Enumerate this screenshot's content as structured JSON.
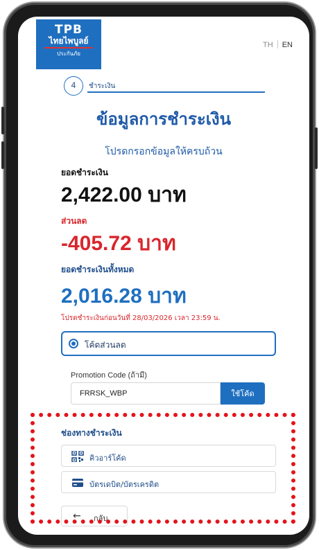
{
  "header": {
    "logo_title": "TPB",
    "logo_name": "ไทยไพบูลย์",
    "logo_sub": "ประกันภัย",
    "lang_th": "TH",
    "lang_en": "EN"
  },
  "step": {
    "number": "4",
    "label": "ชำระเงิน"
  },
  "page": {
    "title": "ข้อมูลการชำระเงิน",
    "subtitle": "โปรดกรอกข้อมูลให้ครบถ้วน"
  },
  "amounts": {
    "total_label": "ยอดชำระเงิน",
    "total_value": "2,422.00 บาท",
    "discount_label": "ส่วนลด",
    "discount_value": "-405.72 บาท",
    "grand_label": "ยอดชำระเงินทั้งหมด",
    "grand_value": "2,016.28 บาท",
    "due_note": "โปรดชำระเงินก่อนวันที่ 28/03/2026 เวลา 23:59 น."
  },
  "discount_option": {
    "label": "โค้ดส่วนลด",
    "selected": true
  },
  "promo": {
    "label": "Promotion Code (ถ้ามี)",
    "value": "FRRSK_WBP",
    "button": "ใช้โค้ด"
  },
  "payment": {
    "title": "ช่องทางชำระเงิน",
    "options": [
      {
        "label": "คิวอาร์โค้ด",
        "icon": "qr-code-icon"
      },
      {
        "label": "บัตรเดบิต/บัตรเครดิต",
        "icon": "credit-card-icon"
      }
    ]
  },
  "back": {
    "label": "กลับ",
    "icon": "arrow-left-icon"
  },
  "colors": {
    "brand_blue": "#1f6fc0",
    "dark_blue": "#1f4e8a",
    "discount_red": "#d9262c",
    "highlight_red": "#e3141b"
  }
}
